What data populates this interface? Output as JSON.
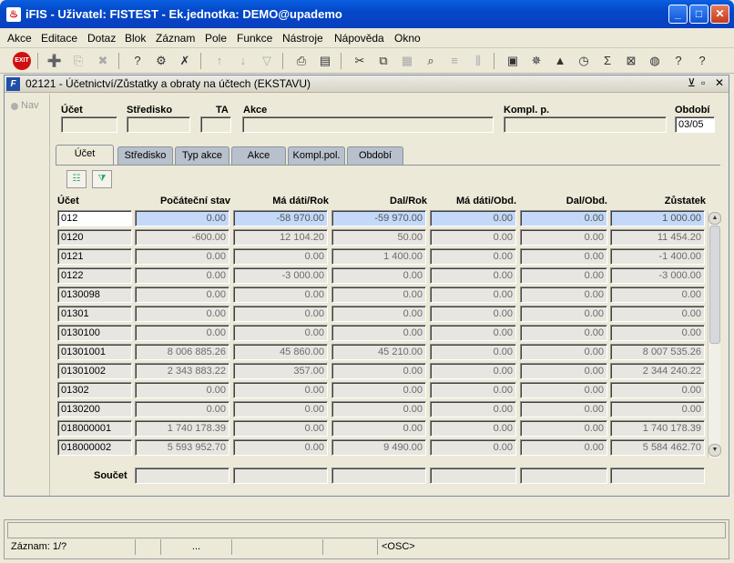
{
  "window": {
    "title": "iFIS - Uživatel: FISTEST - Ek.jednotka: DEMO@upademo",
    "app_icon_glyph": "♨",
    "min_glyph": "_",
    "max_glyph": "□",
    "close_glyph": "✕"
  },
  "menu": [
    "Akce",
    "Editace",
    "Dotaz",
    "Blok",
    "Záznam",
    "Pole",
    "Funkce",
    "Nástroje",
    "Nápověda",
    "Okno"
  ],
  "toolbar": {
    "exit_label": "EXIT"
  },
  "form": {
    "title": "02121 - Účetnictví/Zůstatky a obraty na účtech (EKSTAVU)",
    "icon_glyph": "F",
    "nav_label": "Nav",
    "controls": [
      "⊻",
      "▫",
      "✕"
    ]
  },
  "filters": {
    "ucet_label": "Účet",
    "ucet_value": "",
    "stredisko_label": "Středisko",
    "stredisko_value": "",
    "ta_label": "TA",
    "ta_value": "",
    "akce_label": "Akce",
    "akce_value": "",
    "kompl_label": "Kompl. p.",
    "kompl_value": "",
    "obdobi_label": "Období",
    "obdobi_value": "03/05"
  },
  "tabs": [
    "Účet",
    "Středisko",
    "Typ akce",
    "Akce",
    "Kompl.pol.",
    "Období"
  ],
  "active_tab": "Účet",
  "grid": {
    "headers": [
      "Účet",
      "Počáteční stav",
      "Má dáti/Rok",
      "Dal/Rok",
      "Má dáti/Obd.",
      "Dal/Obd.",
      "Zůstatek"
    ],
    "rows": [
      [
        "012",
        "0.00",
        "-58 970.00",
        "-59 970.00",
        "0.00",
        "0.00",
        "1 000.00"
      ],
      [
        "0120",
        "-600.00",
        "12 104.20",
        "50.00",
        "0.00",
        "0.00",
        "11 454.20"
      ],
      [
        "0121",
        "0.00",
        "0.00",
        "1 400.00",
        "0.00",
        "0.00",
        "-1 400.00"
      ],
      [
        "0122",
        "0.00",
        "-3 000.00",
        "0.00",
        "0.00",
        "0.00",
        "-3 000.00"
      ],
      [
        "0130098",
        "0.00",
        "0.00",
        "0.00",
        "0.00",
        "0.00",
        "0.00"
      ],
      [
        "01301",
        "0.00",
        "0.00",
        "0.00",
        "0.00",
        "0.00",
        "0.00"
      ],
      [
        "0130100",
        "0.00",
        "0.00",
        "0.00",
        "0.00",
        "0.00",
        "0.00"
      ],
      [
        "01301001",
        "8 006 885.26",
        "45 860.00",
        "45 210.00",
        "0.00",
        "0.00",
        "8 007 535.26"
      ],
      [
        "01301002",
        "2 343 883.22",
        "357.00",
        "0.00",
        "0.00",
        "0.00",
        "2 344 240.22"
      ],
      [
        "01302",
        "0.00",
        "0.00",
        "0.00",
        "0.00",
        "0.00",
        "0.00"
      ],
      [
        "0130200",
        "0.00",
        "0.00",
        "0.00",
        "0.00",
        "0.00",
        "0.00"
      ],
      [
        "018000001",
        "1 740 178.39",
        "0.00",
        "0.00",
        "0.00",
        "0.00",
        "1 740 178.39"
      ],
      [
        "018000002",
        "5 593 952.70",
        "0.00",
        "9 490.00",
        "0.00",
        "0.00",
        "5 584 462.70"
      ]
    ],
    "sum_label": "Součet",
    "sums": [
      "",
      "",
      "",
      "",
      "",
      ""
    ]
  },
  "status": {
    "record": "Záznam: 1/?",
    "ellipsis": "...",
    "mode": "<OSC>"
  },
  "colors": {
    "titlebar": "#0348c8",
    "selected_cell": "#c3d9f7",
    "tab_inactive": "#b8c0cc"
  }
}
